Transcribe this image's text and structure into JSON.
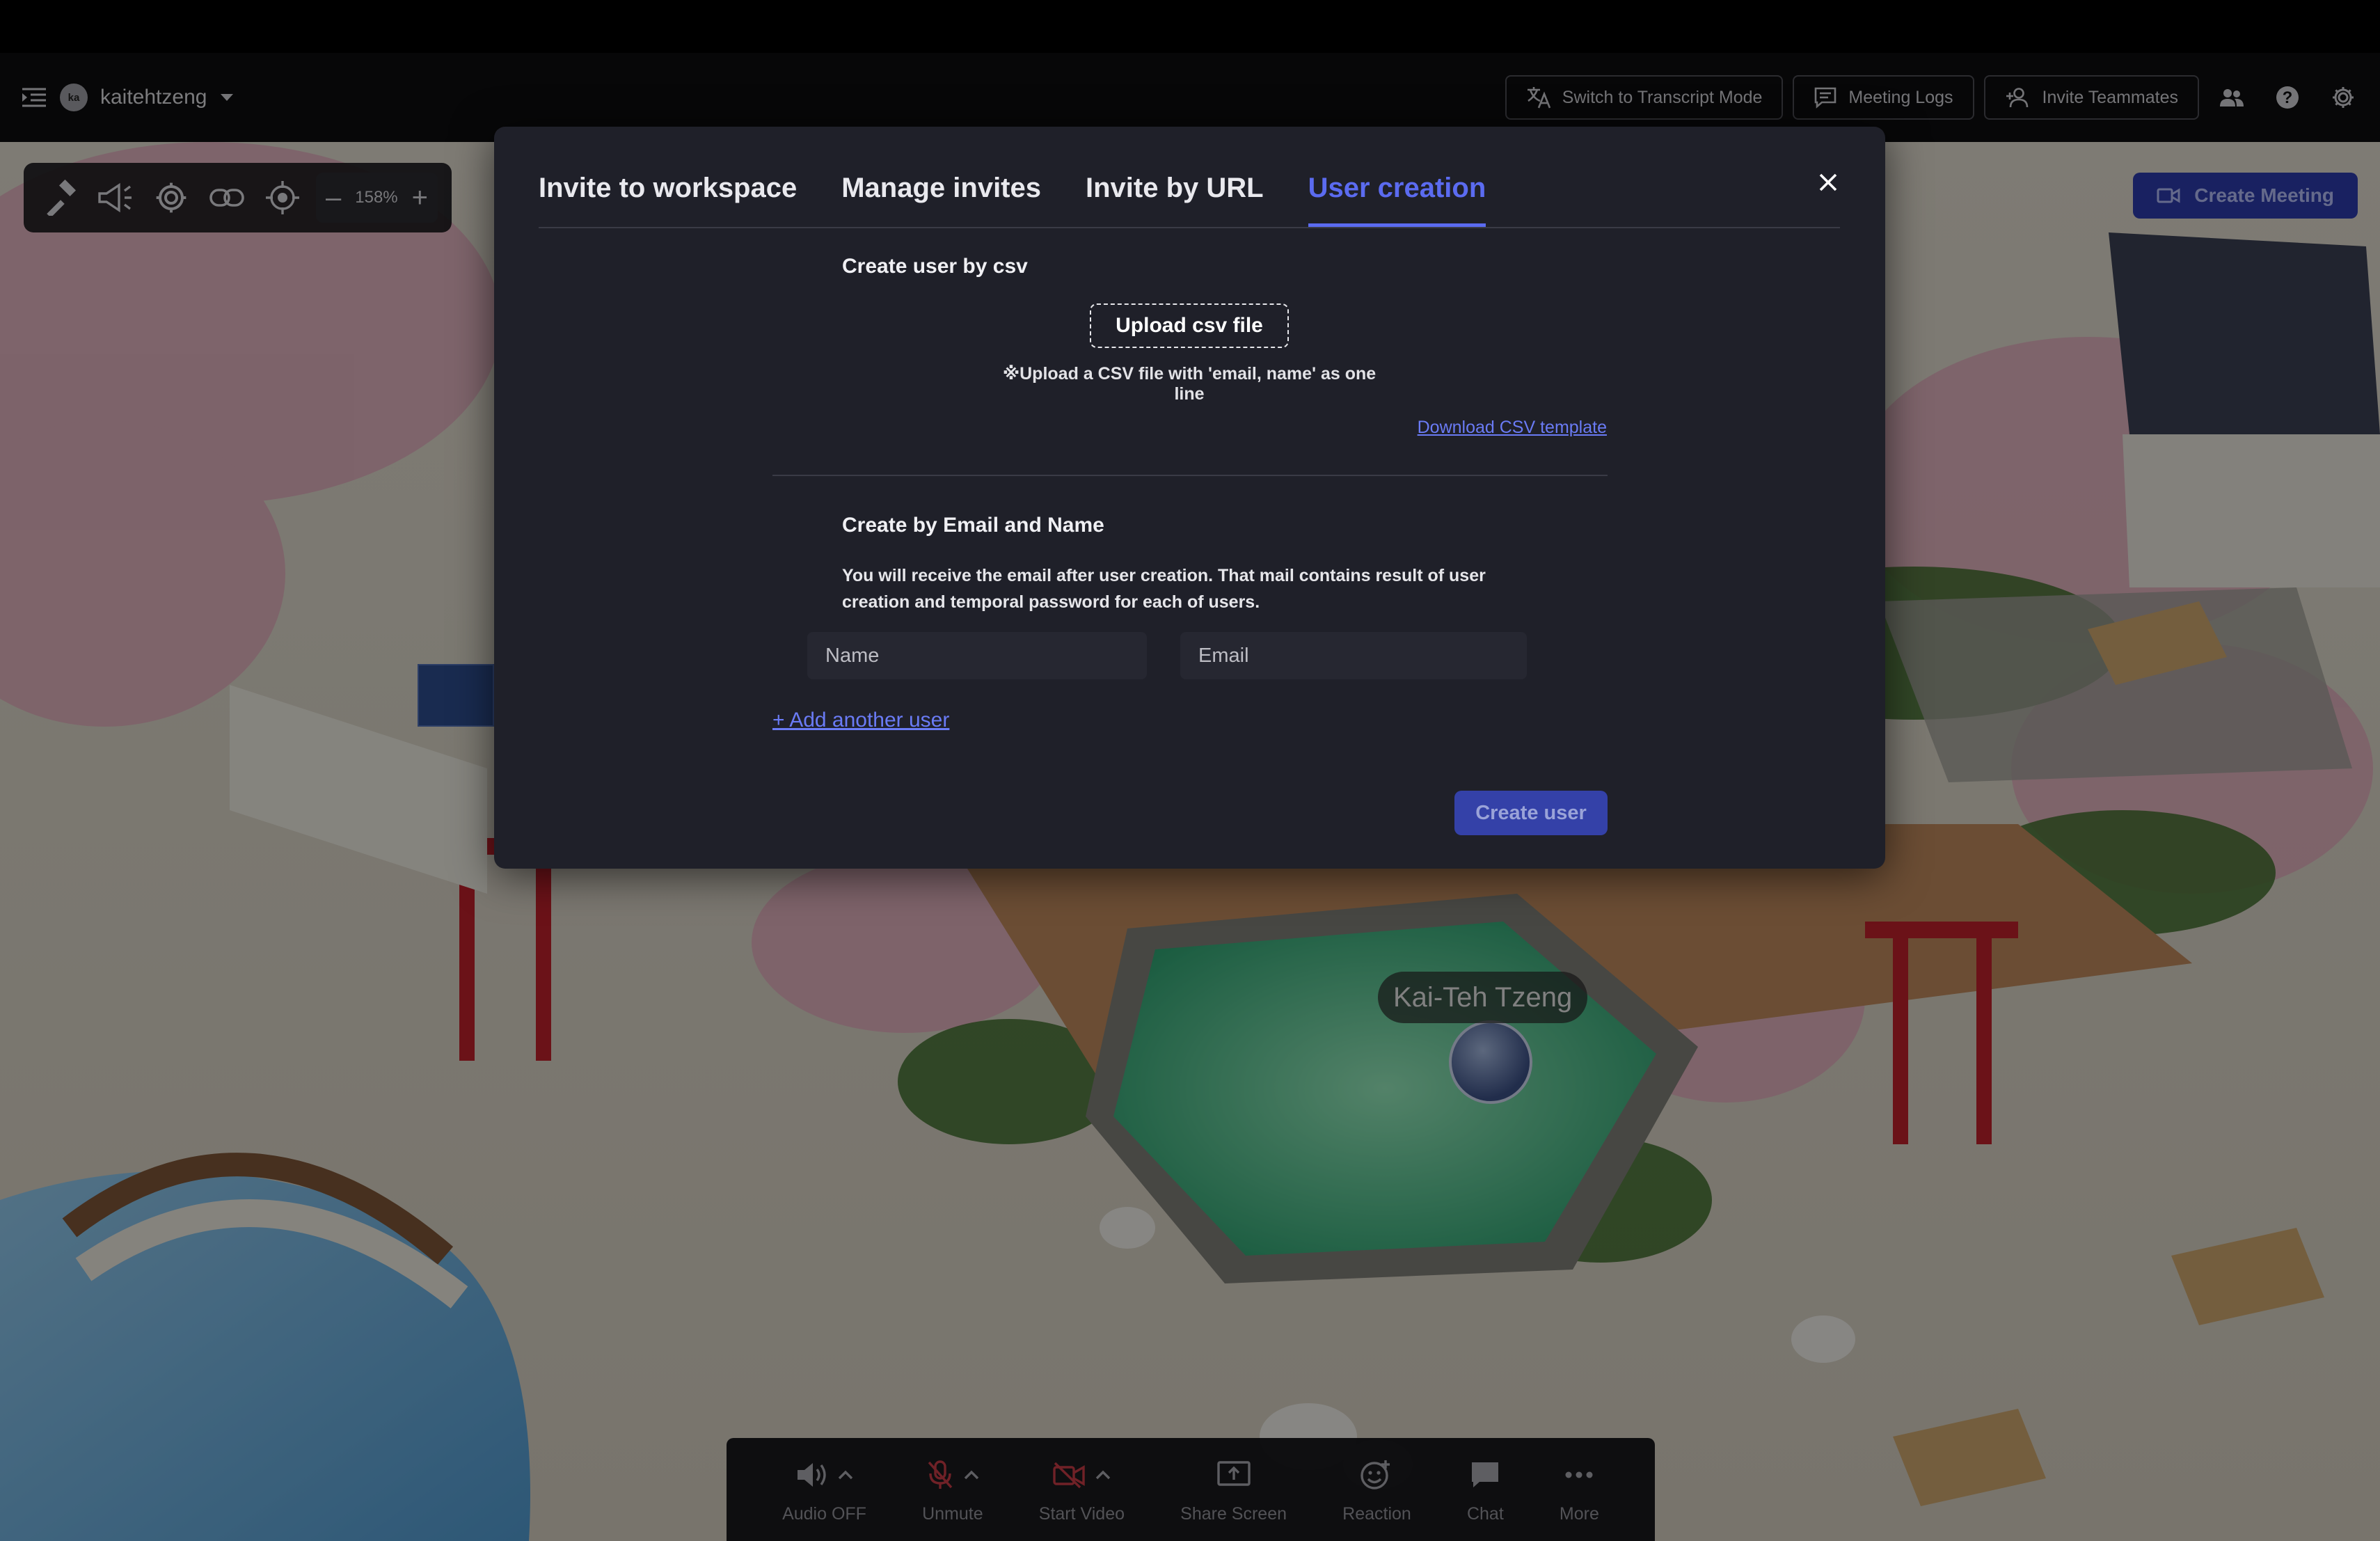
{
  "header": {
    "username": "kaitehtzeng",
    "avatar_initials": "ka",
    "buttons": {
      "transcript": "Switch to Transcript Mode",
      "meeting_logs": "Meeting Logs",
      "invite_teammates": "Invite Teammates"
    }
  },
  "toolbar": {
    "zoom_level": "158%",
    "zoom_minus": "–",
    "zoom_plus": "+"
  },
  "create_meeting_label": "Create Meeting",
  "player": {
    "name": "Kai-Teh Tzeng"
  },
  "modal": {
    "tabs": [
      {
        "label": "Invite to workspace"
      },
      {
        "label": "Manage invites"
      },
      {
        "label": "Invite by URL"
      },
      {
        "label": "User creation"
      }
    ],
    "active_tab": "User creation",
    "csv_section": {
      "title": "Create user by csv",
      "upload_button": "Upload csv file",
      "hint": "※Upload a CSV file with 'email, name' as one line",
      "download_link": "Download CSV template"
    },
    "email_section": {
      "title": "Create by Email and Name",
      "info": "You will receive the email after user creation. That mail contains result of user creation and temporal password for each of users.",
      "name_placeholder": "Name",
      "email_placeholder": "Email",
      "add_user_link": "+ Add another user",
      "submit_button": "Create user"
    }
  },
  "bottom_bar": {
    "audio": "Audio OFF",
    "mic": "Unmute",
    "video": "Start Video",
    "share": "Share Screen",
    "reaction": "Reaction",
    "chat": "Chat",
    "more": "More"
  },
  "colors": {
    "accent": "#5b6bf0",
    "modal_bg": "#1f2029",
    "danger": "#c23a44",
    "primary_button": "#3441a8"
  }
}
